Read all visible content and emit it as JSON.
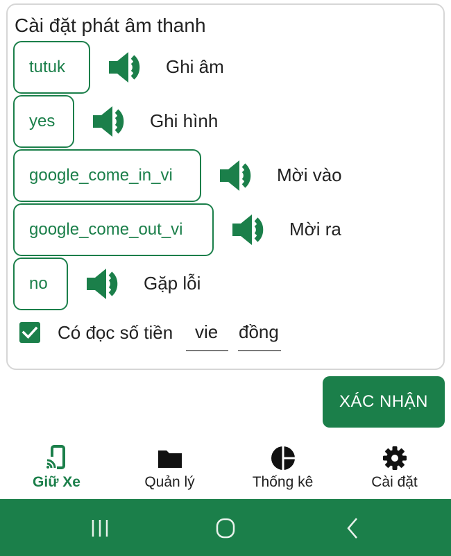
{
  "settings": {
    "title": "Cài đặt phát âm thanh",
    "sounds": [
      {
        "key": "tutuk",
        "label": "Ghi âm"
      },
      {
        "key": "yes",
        "label": "Ghi hình"
      },
      {
        "key": "google_come_in_vi",
        "label": "Mời vào"
      },
      {
        "key": "google_come_out_vi",
        "label": "Mời ra"
      },
      {
        "key": "no",
        "label": "Gặp lỗi"
      }
    ],
    "money": {
      "checked": true,
      "label": "Có đọc số tiền",
      "language": "vie",
      "currency": "đồng"
    }
  },
  "actions": {
    "confirm": "XÁC NHẬN"
  },
  "nav": {
    "items": [
      {
        "label": "Giữ Xe",
        "icon": "phone-cast-icon",
        "active": true
      },
      {
        "label": "Quản lý",
        "icon": "folder-icon",
        "active": false
      },
      {
        "label": "Thống kê",
        "icon": "pie-chart-icon",
        "active": false
      },
      {
        "label": "Cài đặt",
        "icon": "gear-icon",
        "active": false
      }
    ]
  },
  "system_nav": {
    "buttons": [
      "recent-apps-icon",
      "home-icon",
      "back-icon"
    ]
  },
  "colors": {
    "accent": "#1b7f4a",
    "text": "#1f1f1f",
    "panel_border": "#d6d6d6"
  }
}
